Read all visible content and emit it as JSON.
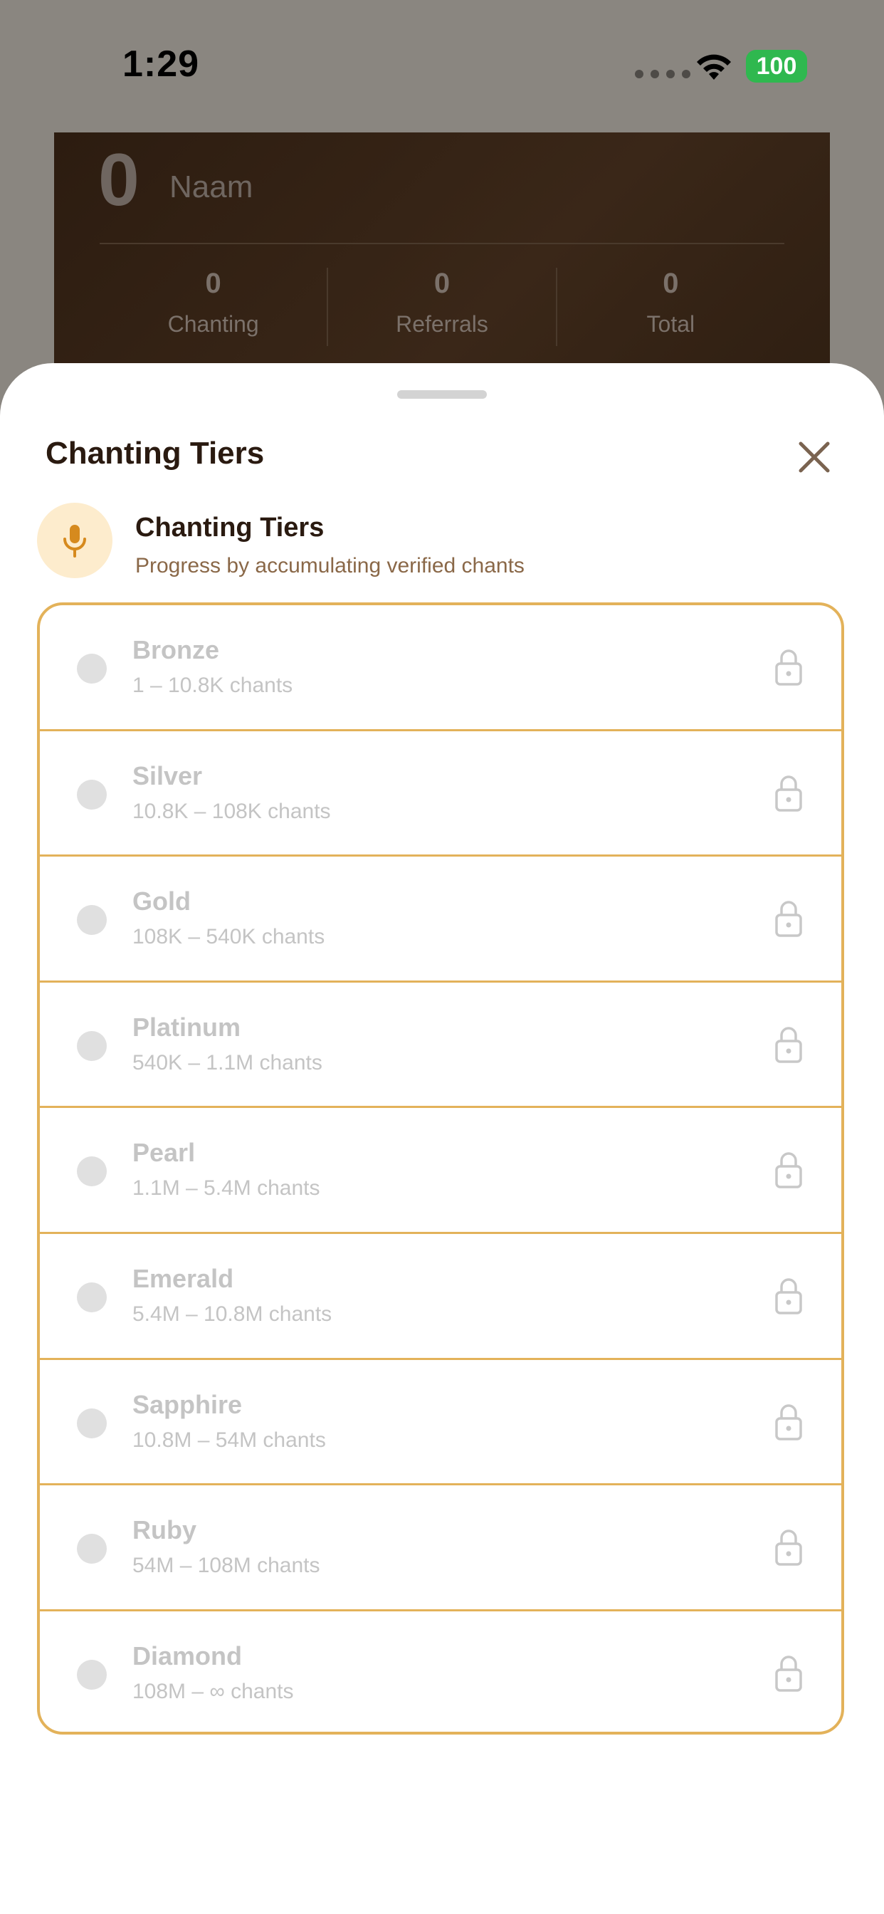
{
  "status_bar": {
    "time": "1:29",
    "battery": "100"
  },
  "background_card": {
    "count": "0",
    "unit": "Naam",
    "stats": [
      {
        "value": "0",
        "label": "Chanting"
      },
      {
        "value": "0",
        "label": "Referrals"
      },
      {
        "value": "0",
        "label": "Total"
      }
    ]
  },
  "sheet": {
    "title": "Chanting Tiers",
    "header": {
      "title": "Chanting Tiers",
      "subtitle": "Progress by accumulating verified chants",
      "icon": "microphone-icon"
    },
    "tiers": [
      {
        "name": "Bronze",
        "range": "1 – 10.8K chants",
        "locked": true
      },
      {
        "name": "Silver",
        "range": "10.8K – 108K chants",
        "locked": true
      },
      {
        "name": "Gold",
        "range": "108K – 540K chants",
        "locked": true
      },
      {
        "name": "Platinum",
        "range": "540K – 1.1M chants",
        "locked": true
      },
      {
        "name": "Pearl",
        "range": "1.1M – 5.4M chants",
        "locked": true
      },
      {
        "name": "Emerald",
        "range": "5.4M – 10.8M chants",
        "locked": true
      },
      {
        "name": "Sapphire",
        "range": "10.8M – 54M chants",
        "locked": true
      },
      {
        "name": "Ruby",
        "range": "54M – 108M chants",
        "locked": true
      },
      {
        "name": "Diamond",
        "range": "108M – ∞ chants",
        "locked": true
      }
    ]
  },
  "colors": {
    "accent_border": "#e3b25a",
    "mic_background": "#fdeccd",
    "mic_icon": "#d68a1e",
    "title_text": "#2a1a10",
    "subtitle_text": "#8a6848",
    "locked_text": "#c4c4c4"
  }
}
